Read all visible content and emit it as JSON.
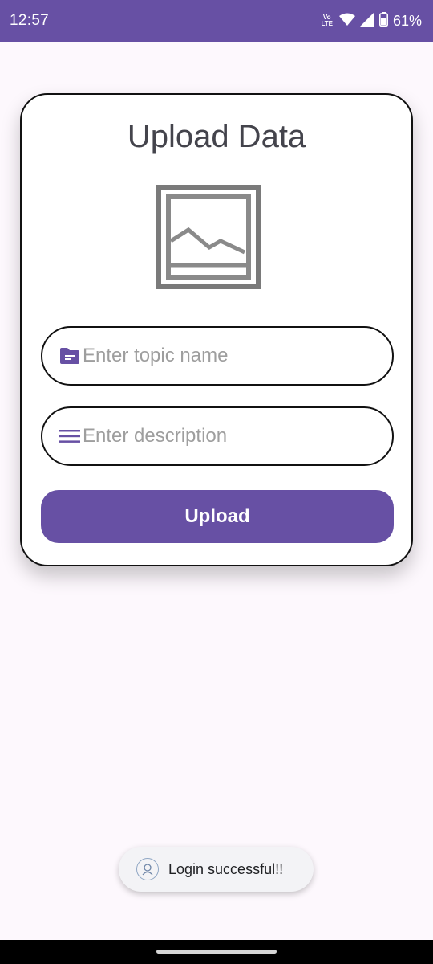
{
  "status_bar": {
    "time": "12:57",
    "network_label": "Vo LTE",
    "battery": "61%"
  },
  "upload_card": {
    "title": "Upload Data",
    "image_icon": "image-placeholder-icon",
    "topic_field": {
      "placeholder": "Enter topic name",
      "value": "",
      "icon": "folder-icon"
    },
    "description_field": {
      "placeholder": "Enter description",
      "value": "",
      "icon": "lines-icon"
    },
    "upload_button_label": "Upload"
  },
  "toast": {
    "message": "Login successful!!",
    "icon": "app-logo-icon"
  },
  "colors": {
    "primary": "#6750a4",
    "background": "#fdf8fd",
    "card": "#ffffff",
    "placeholder_text": "#9e9e9e"
  }
}
